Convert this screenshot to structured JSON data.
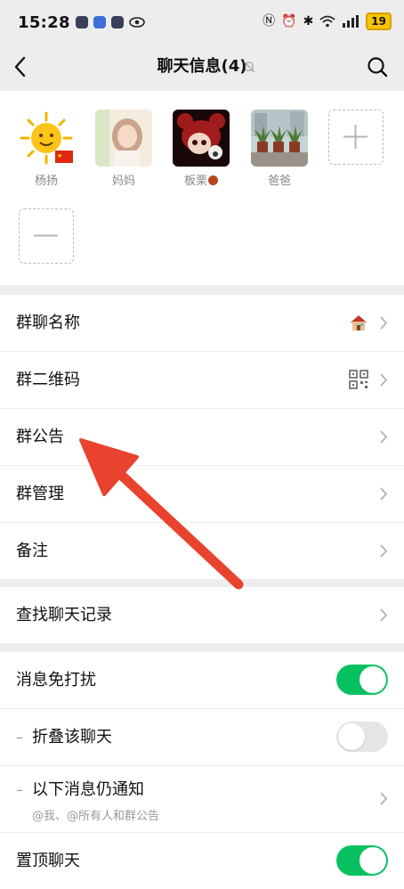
{
  "status_bar": {
    "time": "15:28",
    "battery": "19"
  },
  "nav": {
    "title": "聊天信息(4)"
  },
  "members": [
    {
      "name": "杨扬"
    },
    {
      "name": "妈妈"
    },
    {
      "name": "板栗"
    },
    {
      "name": "爸爸"
    }
  ],
  "group_settings": {
    "name_label": "群聊名称",
    "qr_label": "群二维码",
    "notice_label": "群公告",
    "manage_label": "群管理",
    "remark_label": "备注"
  },
  "search_history": {
    "label": "查找聊天记录"
  },
  "notify_settings": {
    "mute_label": "消息免打扰",
    "mute_on": true,
    "fold_label": "折叠该聊天",
    "fold_on": false,
    "notify_label": "以下消息仍通知",
    "notify_sub": "@我、@所有人和群公告",
    "pin_label": "置顶聊天",
    "pin_on": true
  },
  "colors": {
    "accent": "#07c160",
    "annotation_arrow": "#e8432f"
  }
}
